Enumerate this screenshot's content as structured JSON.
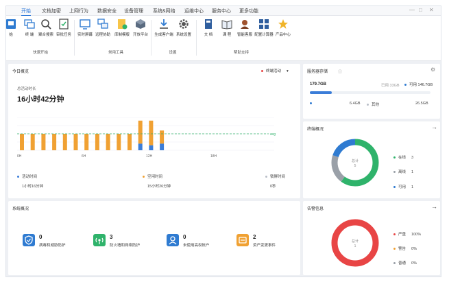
{
  "menu": {
    "tabs": [
      "开始",
      "文档加密",
      "上网行为",
      "数据安全",
      "设备管理",
      "系统&网络",
      "运维中心",
      "服务中心",
      "更多功能"
    ],
    "active_tab": 0
  },
  "ribbon": {
    "buttons": [
      {
        "label": "始",
        "icon": "monitor-icon"
      },
      {
        "label": "终 端",
        "icon": "terminals-icon"
      },
      {
        "label": "聚合搜索",
        "icon": "search-icon"
      },
      {
        "label": "审批任务",
        "icon": "checklist-icon"
      },
      {
        "label": "实时屏幕",
        "icon": "screen-icon"
      },
      {
        "label": "远程协助",
        "icon": "remote-icon"
      },
      {
        "label": "库制模版",
        "icon": "template-icon"
      },
      {
        "label": "开放平台",
        "icon": "cubes-icon"
      },
      {
        "label": "生成客户端",
        "icon": "download-icon"
      },
      {
        "label": "系统设置",
        "icon": "gear-icon"
      },
      {
        "label": "文 档",
        "icon": "book-icon"
      },
      {
        "label": "课 程",
        "icon": "open-book-icon"
      },
      {
        "label": "智能客服",
        "icon": "agent-icon"
      },
      {
        "label": "配置计算器",
        "icon": "calculator-icon"
      },
      {
        "label": "产品中心",
        "icon": "star-icon"
      }
    ],
    "groups": [
      "快速开始",
      "常用工具",
      "设置",
      "帮助支持"
    ]
  },
  "today": {
    "title": "今日概览",
    "selector": "终端活动",
    "duration_label": "总活动时长",
    "duration_value": "16小时42分钟",
    "avg_label": "avg",
    "x_ticks": [
      "0H",
      "6H",
      "12H",
      "18H"
    ],
    "legend": [
      {
        "name": "活动时间",
        "value": "1小时16分钟",
        "color": "#3b7dd8"
      },
      {
        "name": "空闲时间",
        "value": "15小时26分钟",
        "color": "#f0a133"
      },
      {
        "name": "锁屏时间",
        "value": "0秒",
        "color": "#b9bec7"
      }
    ]
  },
  "server": {
    "title": "服务器存储",
    "total": "179.7GB",
    "used": "已用 33GB",
    "available": "可用 146.7GB",
    "used_fraction": 0.18,
    "row_value": "6.4GB",
    "row_label2": "其他",
    "row_value2": "26.5GB"
  },
  "terminal": {
    "title": "终端概况",
    "center_label": "总计",
    "center_value": "5",
    "legend": [
      {
        "name": "在线",
        "value": "3",
        "color": "#2fb36b"
      },
      {
        "name": "离线",
        "value": "1",
        "color": "#9aa0a8"
      },
      {
        "name": "可用",
        "value": "1",
        "color": "#2f7bd1"
      }
    ]
  },
  "system": {
    "title": "系统概况",
    "items": [
      {
        "count": "0",
        "label": "病毒和威胁防护",
        "color": "#2f7bd1",
        "icon": "shield-icon"
      },
      {
        "count": "3",
        "label": "防火墙和网络防护",
        "color": "#2fb36b",
        "icon": "wifi-icon"
      },
      {
        "count": "0",
        "label": "未使用高权帐户",
        "color": "#2f7bd1",
        "icon": "user-icon"
      },
      {
        "count": "2",
        "label": "资产变更事件",
        "color": "#f0a133",
        "icon": "asset-icon"
      }
    ]
  },
  "alerts": {
    "title": "告警信息",
    "center_label": "总计",
    "center_value": "1",
    "legend": [
      {
        "name": "严重",
        "value": "100%",
        "color": "#e84545"
      },
      {
        "name": "警告",
        "value": "0%",
        "color": "#f0a133"
      },
      {
        "name": "普通",
        "value": "0%",
        "color": "#9aa0a8"
      }
    ]
  },
  "chart_data": {
    "type": "bar",
    "categories": [
      "0",
      "1",
      "2",
      "3",
      "4",
      "5",
      "6",
      "7",
      "8",
      "9",
      "10",
      "11",
      "12",
      "13"
    ],
    "series": [
      {
        "name": "活动时间",
        "values": [
          0,
          0,
          0,
          0,
          0,
          0,
          0,
          0,
          0,
          0,
          0,
          0.4,
          0.3,
          0.4
        ]
      },
      {
        "name": "空闲时间",
        "values": [
          1,
          1,
          1,
          1,
          1,
          1,
          1,
          1,
          1,
          1,
          1,
          1.4,
          1.5,
          0.8
        ]
      }
    ],
    "xlabel": "",
    "ylabel": "",
    "x_ticks": [
      "0H",
      "6H",
      "12H",
      "18H"
    ],
    "avg_line": "avg",
    "stacked": true
  }
}
